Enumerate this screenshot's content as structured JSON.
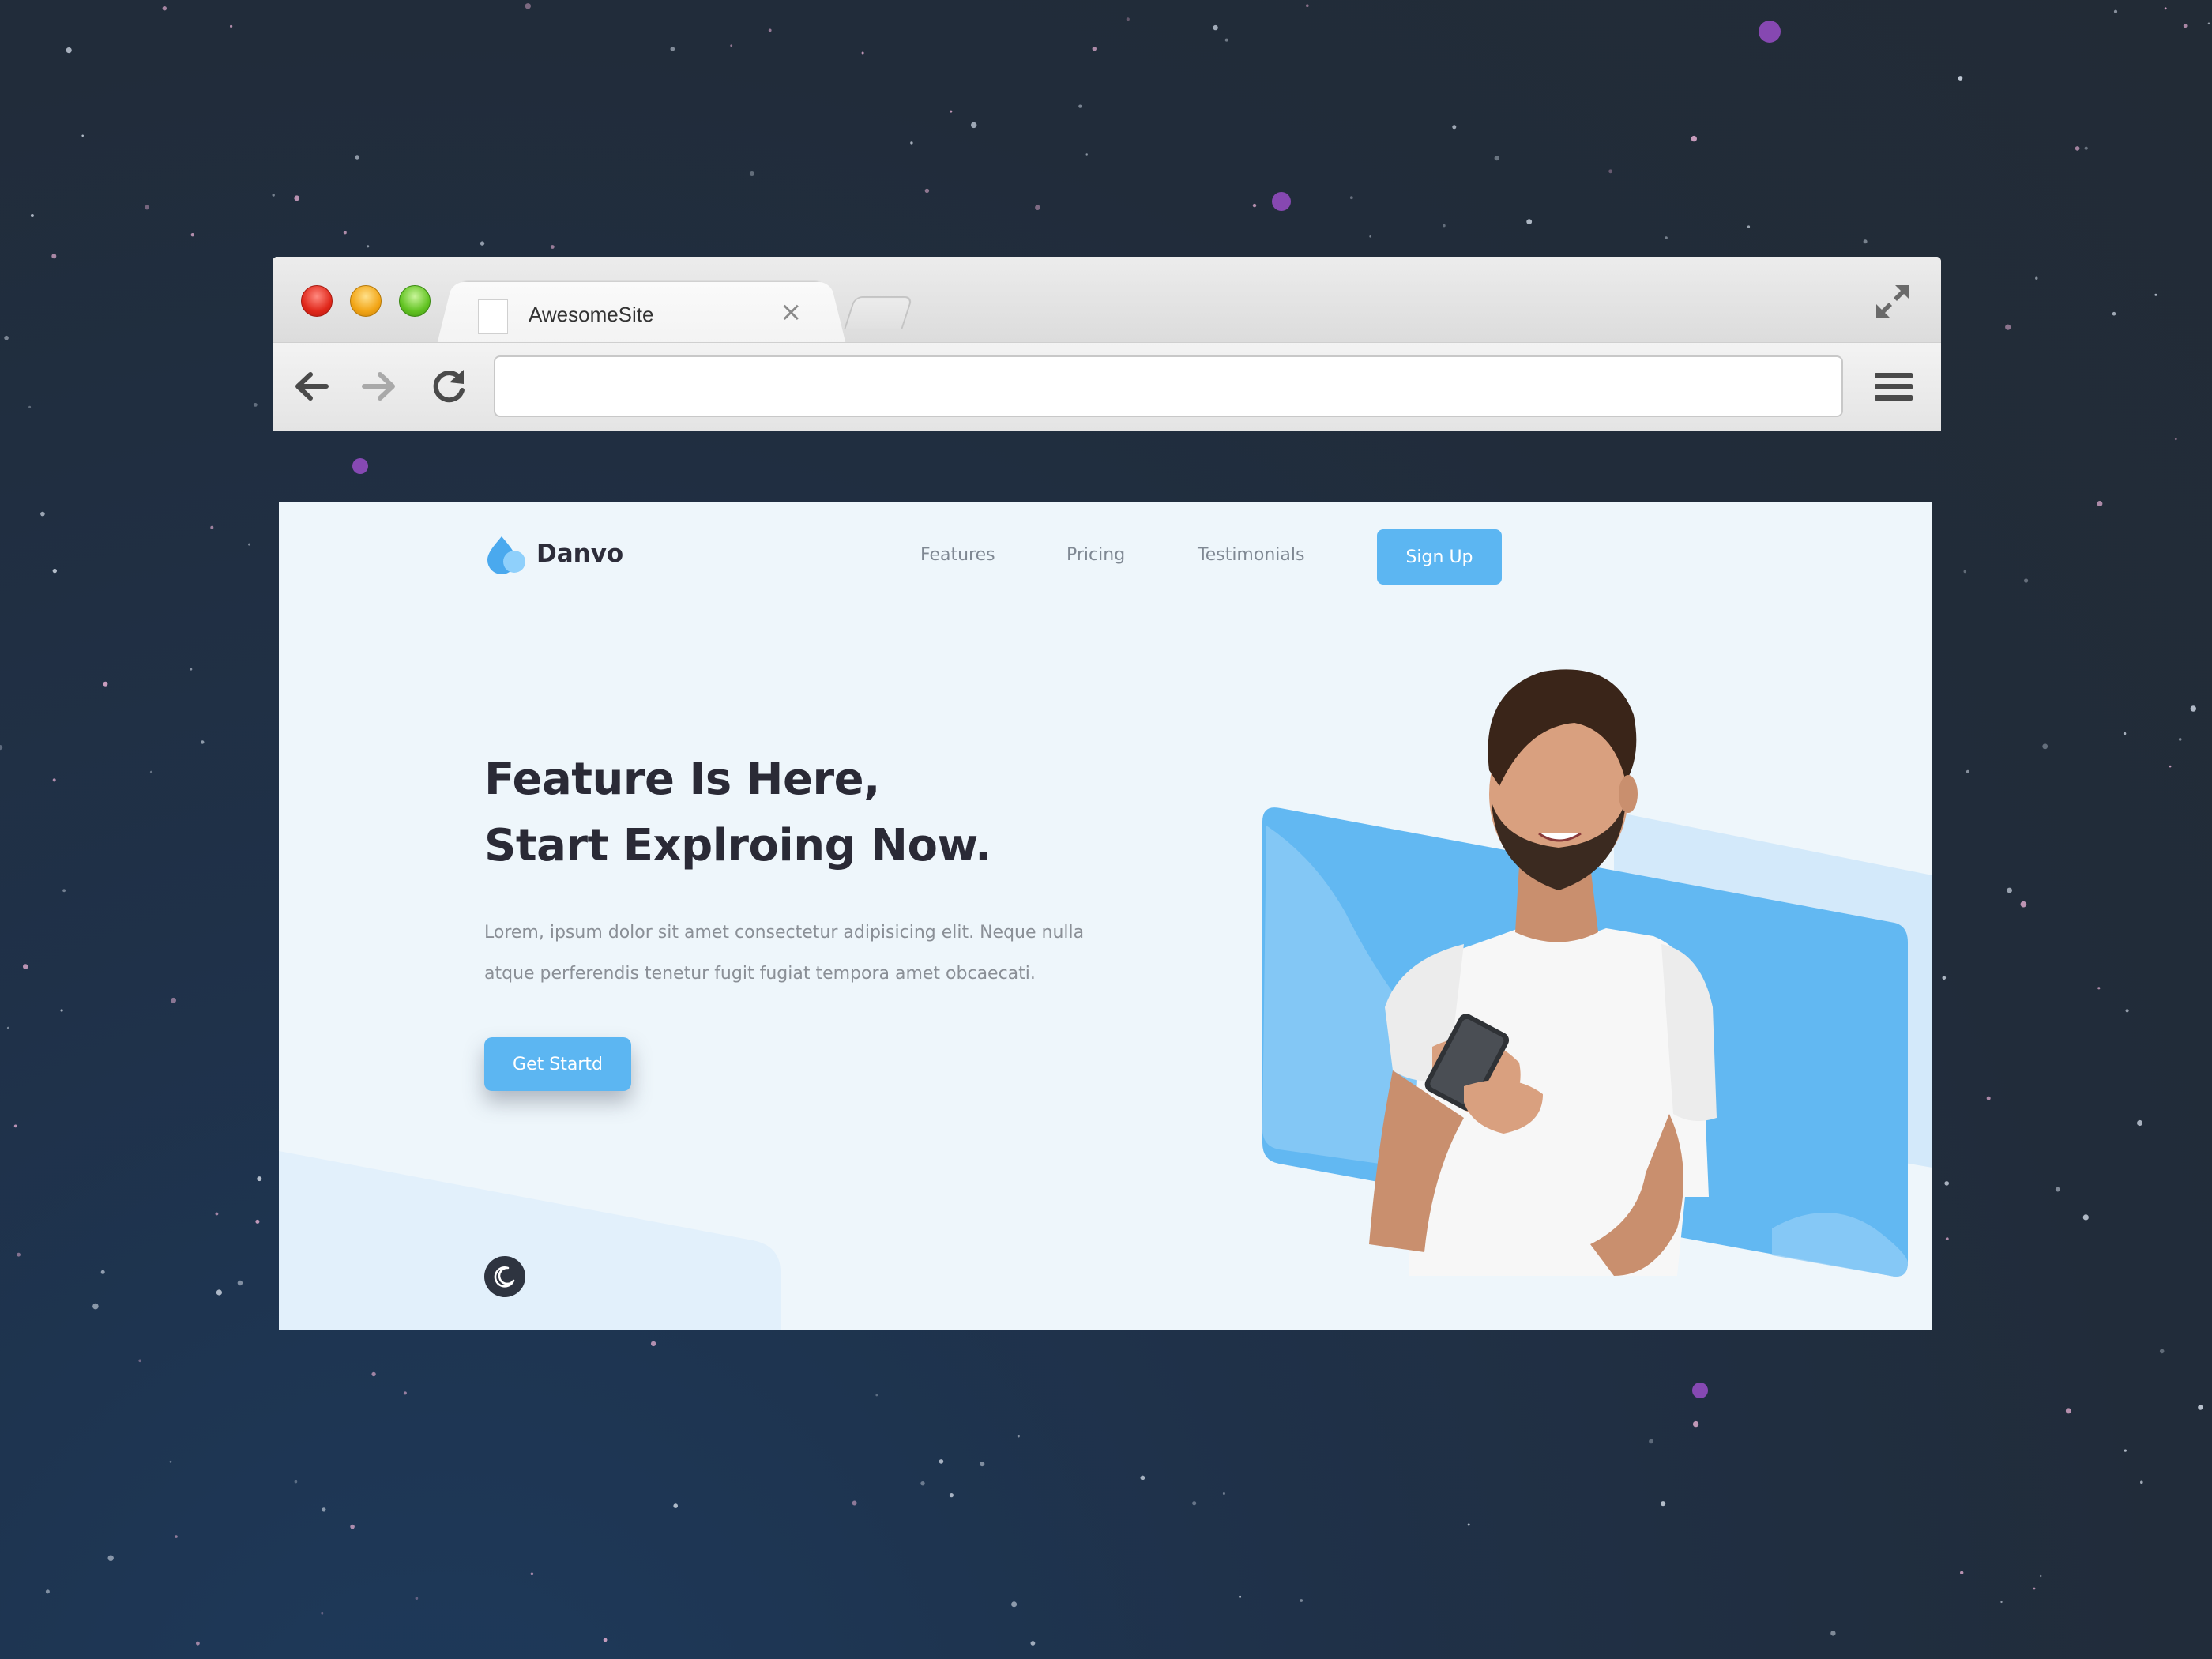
{
  "browser": {
    "tab_title": "AwesomeSite",
    "tab_close_glyph": "×",
    "address_value": "",
    "icons": [
      "back-arrow-icon",
      "forward-arrow-icon",
      "reload-icon",
      "hamburger-menu-icon",
      "fullscreen-icon",
      "favicon-page-icon"
    ]
  },
  "site": {
    "brand": "Danvo",
    "nav": [
      "Features",
      "Pricing",
      "Testimonials"
    ],
    "signup_label": "Sign Up",
    "hero_title_line1": "Feature Is Here,",
    "hero_title_line2": "Start Explroing Now.",
    "hero_desc_line1": "Lorem, ipsum dolor sit amet consectetur adipisicing elit. Neque nulla",
    "hero_desc_line2": "atque perferendis tenetur fugit fugiat tempora amet obcaecati.",
    "cta_label": "Get Startd",
    "theme_toggle_icon": "moon-icon"
  },
  "colors": {
    "accent": "#5cb6f2",
    "page_bg": "#eef6fb",
    "heading": "#2a2a36",
    "muted": "#8a8f96",
    "desktop_bg": "#222b36"
  }
}
